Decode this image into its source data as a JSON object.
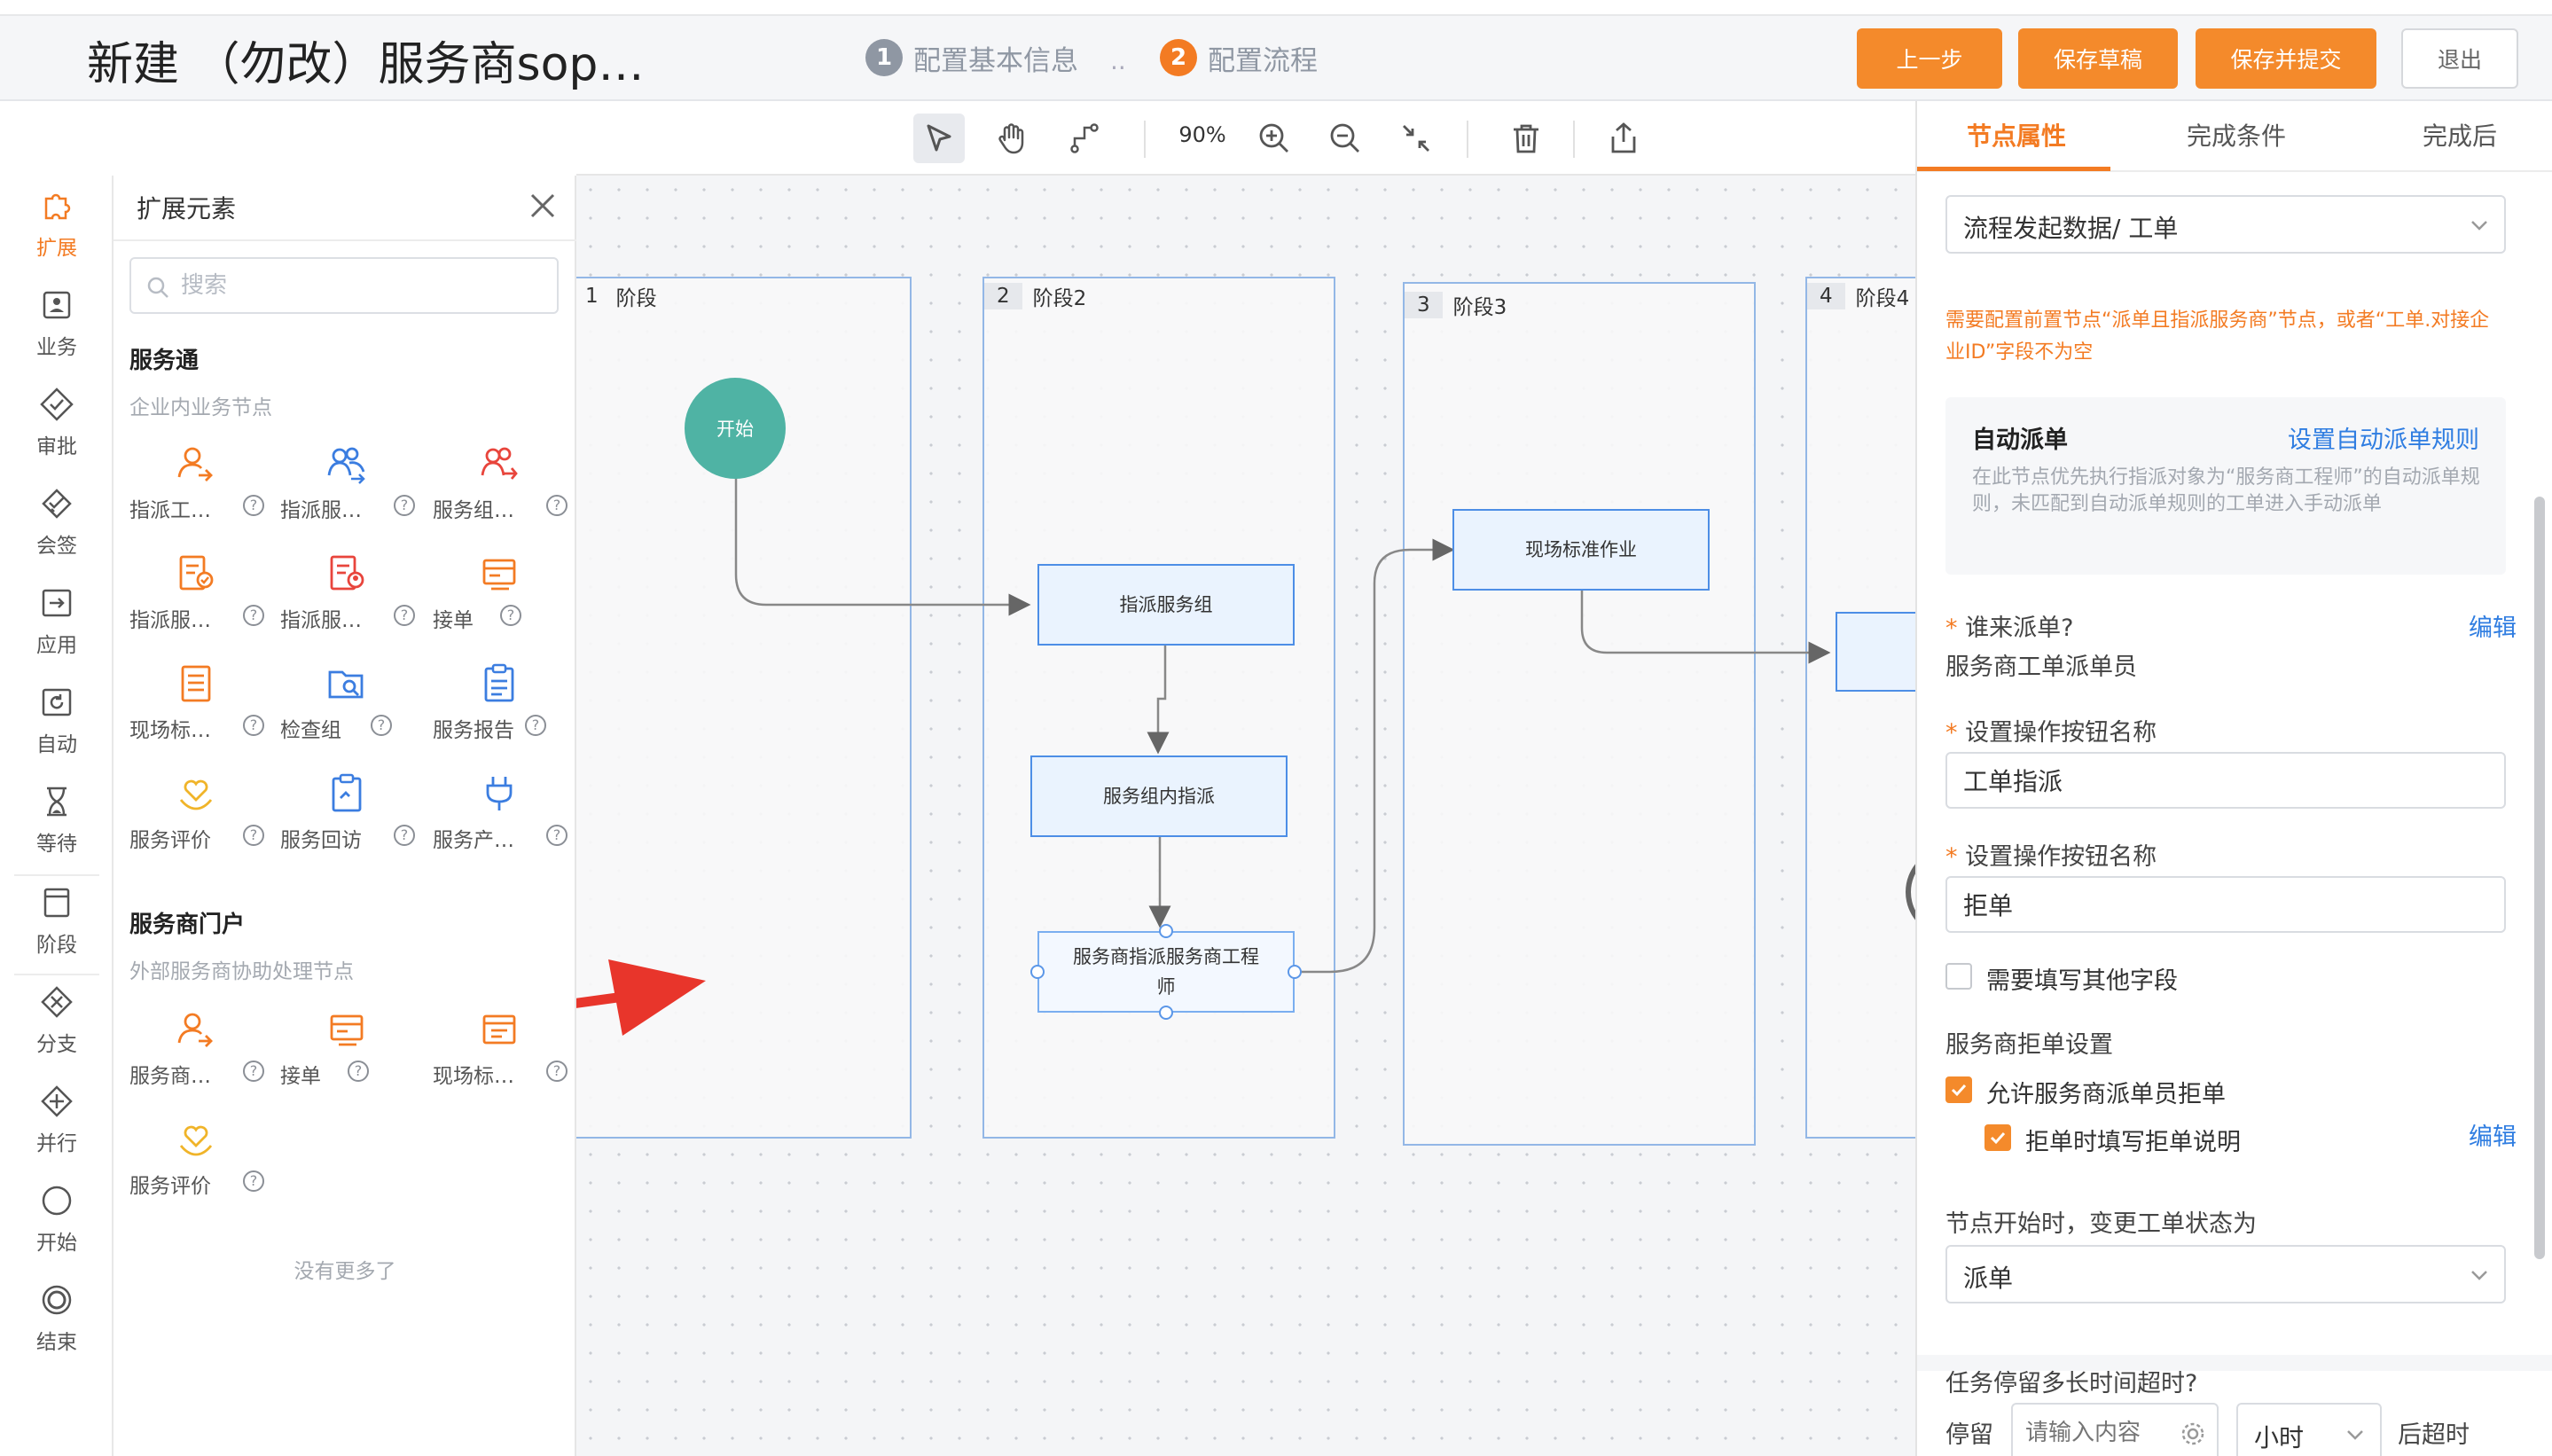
{
  "header": {
    "title": "新建 （勿改）服务商sop…",
    "steps": [
      {
        "num": "1",
        "label": "配置基本信息"
      },
      {
        "num": "2",
        "label": "配置流程"
      }
    ],
    "step_sep": "..",
    "buttons": {
      "prev": "上一步",
      "save_draft": "保存草稿",
      "save_submit": "保存并提交",
      "exit": "退出"
    },
    "accent": "#f48a2b"
  },
  "toolbar": {
    "zoom": "90%",
    "tools": [
      "select-arrow-icon",
      "hand-pan-icon",
      "connector-icon",
      "zoom-in-icon",
      "zoom-out-icon",
      "fit-collapse-icon",
      "delete-icon",
      "export-icon"
    ]
  },
  "rail": {
    "items": [
      {
        "label": "扩展",
        "icon": "puzzle-icon",
        "active": true
      },
      {
        "label": "业务",
        "icon": "business-icon"
      },
      {
        "label": "审批",
        "icon": "approve-icon"
      },
      {
        "label": "会签",
        "icon": "countersign-icon"
      },
      {
        "label": "应用",
        "icon": "app-icon"
      },
      {
        "label": "自动",
        "icon": "auto-icon"
      },
      {
        "label": "等待",
        "icon": "hourglass-icon"
      },
      {
        "label": "阶段",
        "icon": "stage-icon"
      },
      {
        "label": "分支",
        "icon": "branch-icon"
      },
      {
        "label": "并行",
        "icon": "parallel-icon"
      },
      {
        "label": "开始",
        "icon": "start-circle-icon"
      },
      {
        "label": "结束",
        "icon": "end-circle-icon"
      }
    ]
  },
  "ext": {
    "title": "扩展元素",
    "search_placeholder": "搜索",
    "section1": {
      "title": "服务通",
      "sub": "企业内业务节点",
      "nodes": [
        "指派工…",
        "指派服…",
        "服务组…",
        "指派服…",
        "指派服…",
        "接单",
        "现场标…",
        "检查组",
        "服务报告",
        "服务评价",
        "服务回访",
        "服务产…"
      ]
    },
    "section2": {
      "title": "服务商门户",
      "sub": "外部服务商协助处理节点",
      "nodes": [
        "服务商…",
        "接单",
        "现场标…",
        "服务评价"
      ]
    },
    "no_more": "没有更多了"
  },
  "canvas": {
    "stages": [
      {
        "num": "1",
        "label": "阶段"
      },
      {
        "num": "2",
        "label": "阶段2"
      },
      {
        "num": "3",
        "label": "阶段3"
      },
      {
        "num": "4",
        "label": "阶段4"
      }
    ],
    "start_label": "开始",
    "nodes": {
      "assign_group": "指派服务组",
      "group_assign": "服务组内指派",
      "sp_assign_1": "服务商指派服务商工程",
      "sp_assign_2": "师",
      "onsite": "现场标准作业"
    }
  },
  "panel": {
    "tabs": [
      "节点属性",
      "完成条件",
      "完成后"
    ],
    "source_select": "流程发起数据/ 工单",
    "warning": "需要配置前置节点“派单且指派服务商”节点，或者“工单.对接企业ID”字段不为空",
    "auto_dispatch": {
      "title": "自动派单",
      "link": "设置自动派单规则",
      "desc": "在此节点优先执行指派对象为“服务商工程师”的自动派单规则，未匹配到自动派单规则的工单进入手动派单"
    },
    "who_dispatch_label": "谁来派单?",
    "who_dispatch_value": "服务商工单派单员",
    "edit": "编辑",
    "btn_name_label": "设置操作按钮名称",
    "btn_name_1": "工单指派",
    "btn_name_2": "拒单",
    "extra_fields_label": "需要填写其他字段",
    "reject_section": "服务商拒单设置",
    "allow_reject_label": "允许服务商派单员拒单",
    "reject_note_label": "拒单时填写拒单说明",
    "status_change_label": "节点开始时，变更工单状态为",
    "status_value": "派单",
    "timeout_label": "任务停留多长时间超时?",
    "stay_label": "停留",
    "timeout_placeholder": "请输入内容",
    "unit": "小时",
    "after_label": "后超时"
  }
}
